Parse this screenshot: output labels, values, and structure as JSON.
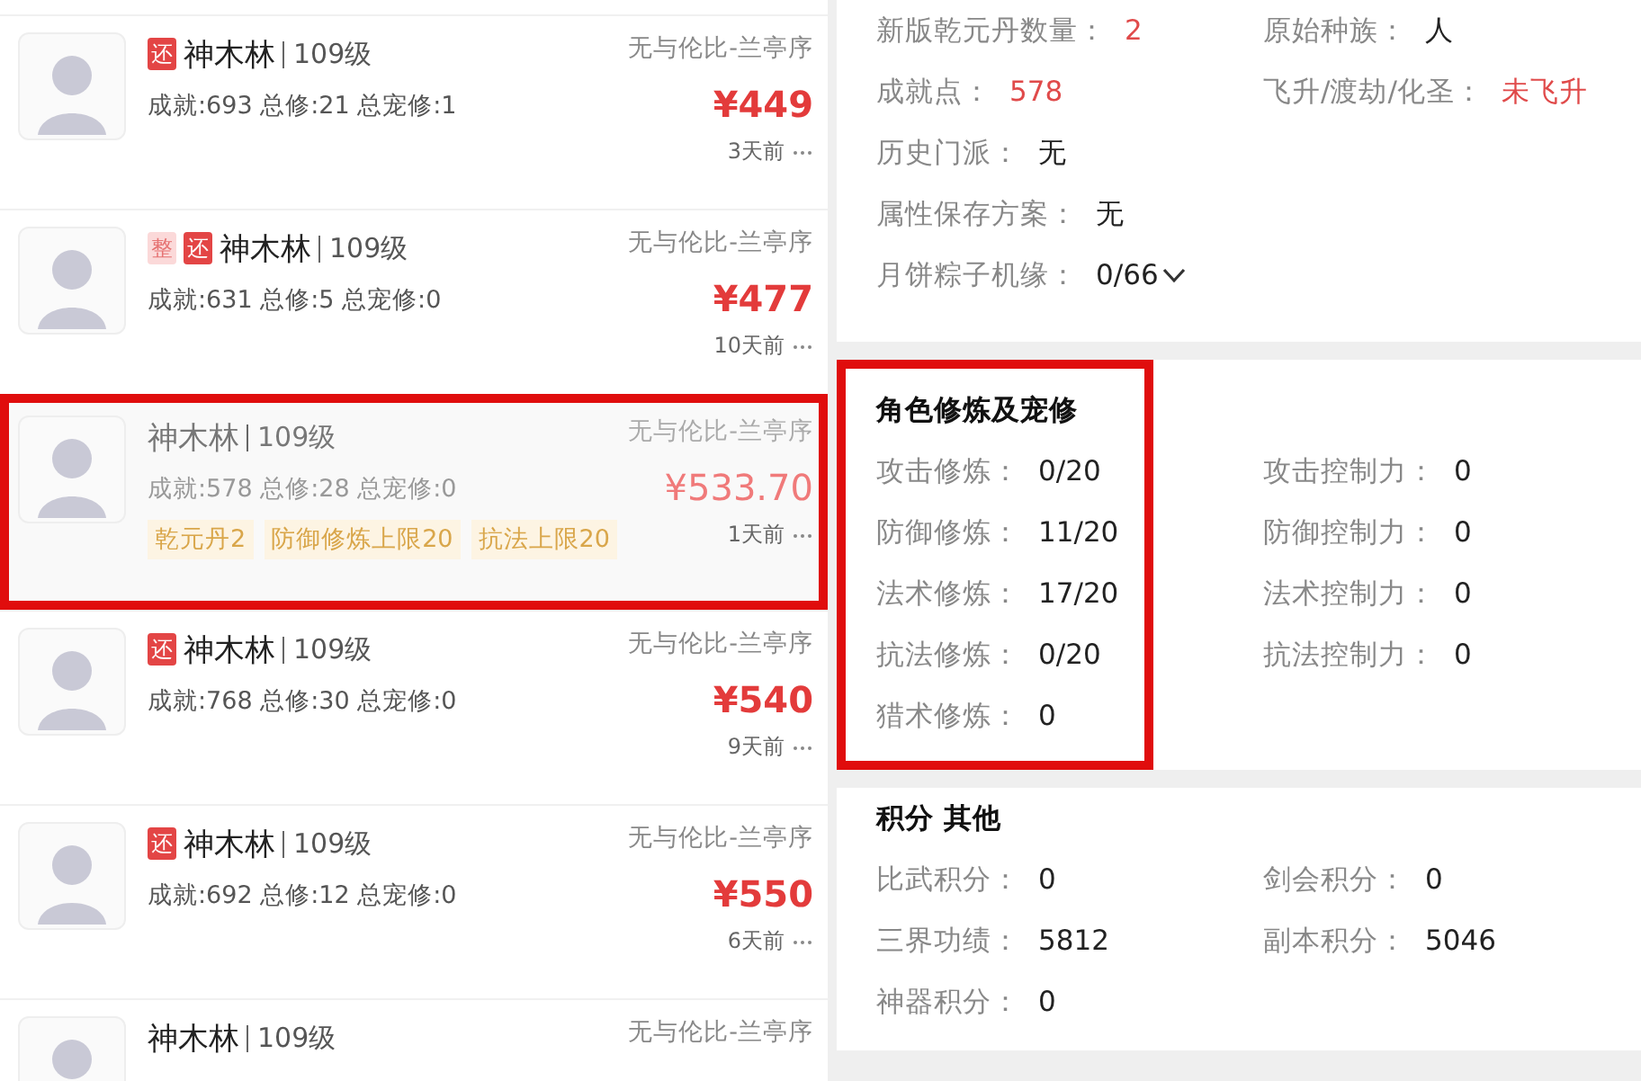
{
  "listings": [
    {
      "badges": [
        {
          "kind": "solid",
          "text": "还"
        }
      ],
      "name": "神木林",
      "level": "109级",
      "stats": "成就:693 总修:21 总宠修:1",
      "server": "无与伦比-兰亭序",
      "price": "¥449",
      "time": "3天前",
      "selected": false,
      "dimmed": false
    },
    {
      "badges": [
        {
          "kind": "light",
          "text": "整"
        },
        {
          "kind": "solid",
          "text": "还"
        }
      ],
      "name": "神木林",
      "level": "109级",
      "stats": "成就:631 总修:5 总宠修:0",
      "server": "无与伦比-兰亭序",
      "price": "¥477",
      "time": "10天前",
      "selected": false,
      "dimmed": false
    },
    {
      "name": "神木林",
      "level": "109级",
      "stats": "成就:578 总修:28 总宠修:0",
      "server": "无与伦比-兰亭序",
      "price": "¥533.70",
      "time": "1天前",
      "tags": [
        "乾元丹2",
        "防御修炼上限20",
        "抗法上限20"
      ],
      "selected": true,
      "dimmed": true
    },
    {
      "badges": [
        {
          "kind": "solid",
          "text": "还"
        }
      ],
      "name": "神木林",
      "level": "109级",
      "stats": "成就:768 总修:30 总宠修:0",
      "server": "无与伦比-兰亭序",
      "price": "¥540",
      "time": "9天前",
      "selected": false,
      "dimmed": false
    },
    {
      "badges": [
        {
          "kind": "solid",
          "text": "还"
        }
      ],
      "name": "神木林",
      "level": "109级",
      "stats": "成就:692 总修:12 总宠修:0",
      "server": "无与伦比-兰亭序",
      "price": "¥550",
      "time": "6天前",
      "selected": false,
      "dimmed": false
    },
    {
      "name": "神木林",
      "level": "109级",
      "server": "无与伦比-兰亭序",
      "selected": false,
      "dimmed": false
    }
  ],
  "details": [
    {
      "boxed": false,
      "left": [
        {
          "label": "新版乾元丹数量：",
          "value": "2",
          "accent": true
        },
        {
          "label": "成就点：",
          "value": "578",
          "accent": true
        },
        {
          "label": "历史门派：",
          "value": "无",
          "accent": false
        },
        {
          "label": "属性保存方案：",
          "value": "无",
          "accent": false
        },
        {
          "label": "月饼粽子机缘：",
          "value": "0/66",
          "accent": false,
          "expanded": false
        }
      ],
      "right": [
        {
          "label": "原始种族：",
          "value": "人",
          "accent": false
        },
        {
          "label": "飞升/渡劫/化圣：",
          "value": "未飞升",
          "accent": true
        }
      ]
    },
    {
      "heading": "角色修炼及宠修",
      "boxed": true,
      "left": [
        {
          "label": "攻击修炼：",
          "value": "0/20",
          "accent": false
        },
        {
          "label": "防御修炼：",
          "value": "11/20",
          "accent": false
        },
        {
          "label": "法术修炼：",
          "value": "17/20",
          "accent": false
        },
        {
          "label": "抗法修炼：",
          "value": "0/20",
          "accent": false
        },
        {
          "label": "猎术修炼：",
          "value": "0",
          "accent": false
        }
      ],
      "right": [
        {
          "label": "攻击控制力：",
          "value": "0",
          "accent": false
        },
        {
          "label": "防御控制力：",
          "value": "0",
          "accent": false
        },
        {
          "label": "法术控制力：",
          "value": "0",
          "accent": false
        },
        {
          "label": "抗法控制力：",
          "value": "0",
          "accent": false
        }
      ]
    },
    {
      "heading": "积分 其他",
      "boxed": false,
      "left": [
        {
          "label": "比武积分：",
          "value": "0",
          "accent": false
        },
        {
          "label": "三界功绩：",
          "value": "5812",
          "accent": false
        },
        {
          "label": "神器积分：",
          "value": "0",
          "accent": false
        }
      ],
      "right": [
        {
          "label": "剑会积分：",
          "value": "0",
          "accent": false
        },
        {
          "label": "副本积分：",
          "value": "5046",
          "accent": false
        }
      ]
    }
  ]
}
